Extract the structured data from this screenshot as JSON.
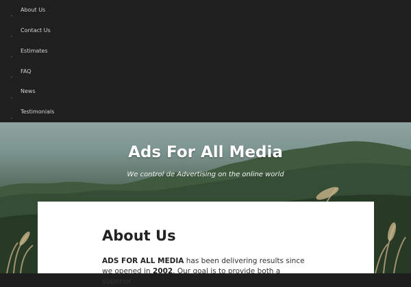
{
  "nav": {
    "items": [
      {
        "label": "About Us"
      },
      {
        "label": "Contact Us"
      },
      {
        "label": "Estimates"
      },
      {
        "label": "FAQ"
      },
      {
        "label": "News"
      },
      {
        "label": "Testimonials"
      }
    ]
  },
  "hero": {
    "title": "Ads For All Media",
    "tagline": "We control de Advertising on the online world"
  },
  "content": {
    "page_title": "About Us",
    "intro": {
      "company": "ADS FOR ALL MEDIA",
      "text1": " has been delivering results since we opened in ",
      "year": "2002",
      "text2": ". Our goal is to provide both a superior"
    }
  },
  "colors": {
    "nav_background": "#1f1f1f",
    "nav_text": "#d6d6d6",
    "title_text": "#ffffff",
    "card_background": "#ffffff"
  }
}
